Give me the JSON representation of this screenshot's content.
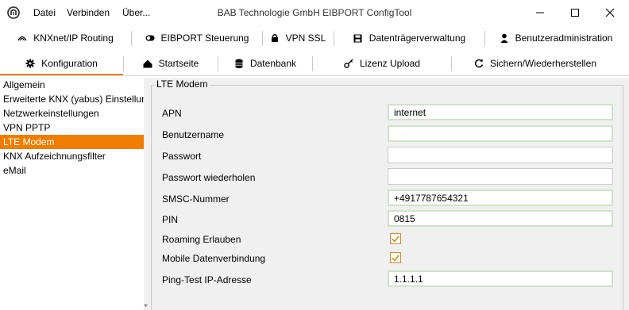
{
  "window": {
    "title": "BAB Technologie GmbH EIBPORT ConfigTool",
    "menu": [
      "Datei",
      "Verbinden",
      "Über..."
    ]
  },
  "tabs_row1": [
    {
      "label": "KNXnet/IP Routing",
      "icon": "knx-routing-icon"
    },
    {
      "label": "EIBPORT Steuerung",
      "icon": "toggle-icon"
    },
    {
      "label": "VPN SSL",
      "icon": "lock-icon"
    },
    {
      "label": "Datenträgerverwaltung",
      "icon": "disk-icon"
    },
    {
      "label": "Benutzeradministration",
      "icon": "user-icon"
    }
  ],
  "tabs_row2": [
    {
      "label": "Konfiguration",
      "icon": "gear-icon",
      "active": true
    },
    {
      "label": "Startseite",
      "icon": "home-icon"
    },
    {
      "label": "Datenbank",
      "icon": "database-icon"
    },
    {
      "label": "Lizenz Upload",
      "icon": "key-icon"
    },
    {
      "label": "Sichern/Wiederherstellen",
      "icon": "backup-icon"
    }
  ],
  "sidebar": {
    "items": [
      {
        "label": "Allgemein"
      },
      {
        "label": "Erweiterte KNX (yabus) Einstellungen"
      },
      {
        "label": "Netzwerkeinstellungen"
      },
      {
        "label": "VPN PPTP"
      },
      {
        "label": "LTE Modem",
        "active": true
      },
      {
        "label": "KNX Aufzeichnungsfilter"
      },
      {
        "label": "eMail"
      }
    ]
  },
  "panel": {
    "title": "LTE Modem",
    "fields": [
      {
        "label": "APN",
        "value": "internet"
      },
      {
        "label": "Benutzername",
        "value": ""
      },
      {
        "label": "Passwort",
        "value": ""
      },
      {
        "label": "Passwort wiederholen",
        "value": ""
      },
      {
        "label": "SMSC-Nummer",
        "value": "+4917787654321"
      },
      {
        "label": "PIN",
        "value": "0815"
      }
    ],
    "checks": [
      {
        "label": "Roaming Erlauben",
        "checked": true
      },
      {
        "label": "Mobile Datenverbindung",
        "checked": true
      }
    ],
    "ping": {
      "label": "Ping-Test IP-Adresse",
      "value": "1.1.1.1"
    }
  },
  "colors": {
    "accent": "#f07d00",
    "field_border_valid": "#cfe3c9"
  }
}
